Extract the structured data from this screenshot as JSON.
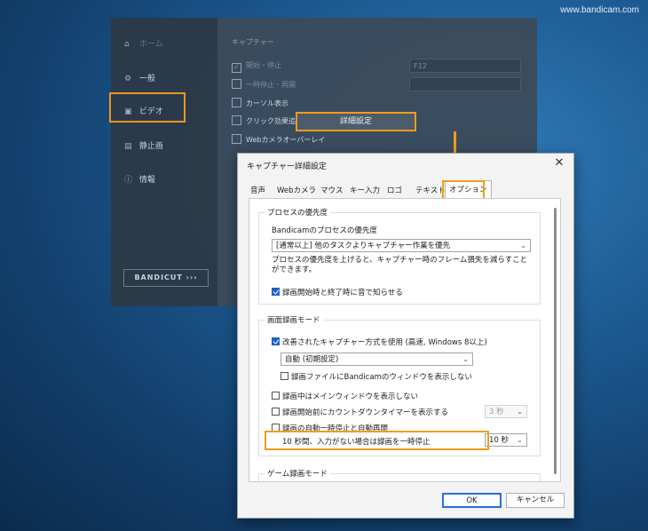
{
  "watermark": "www.bandicam.com",
  "bg_app": {
    "sidebar": {
      "items": [
        {
          "label": "ホーム",
          "icon": "home-icon"
        },
        {
          "label": "一般",
          "icon": "gear-icon"
        },
        {
          "label": "ビデオ",
          "icon": "video-icon"
        },
        {
          "label": "静止画",
          "icon": "image-icon"
        },
        {
          "label": "情報",
          "icon": "info-icon"
        }
      ],
      "bandicut_label": "BANDICUT ›››"
    },
    "section_label": "キャプチャー",
    "options": [
      {
        "label": "開始・停止",
        "checked": true
      },
      {
        "label": "一時停止・再開",
        "checked": false
      },
      {
        "label": "カーソル表示",
        "checked": false
      },
      {
        "label": "クリック効果追加",
        "checked": false
      },
      {
        "label": "Webカメラオーバーレイ",
        "checked": false
      }
    ],
    "hotkey_value": "F12",
    "hotkey2_value": "",
    "advanced_button": "詳細設定",
    "fragments": [
      "フ",
      "ピ",
      "オ"
    ]
  },
  "accent_color": "#f29b1b",
  "dialog": {
    "title": "キャプチャー詳細設定",
    "close_glyph": "✕",
    "tabs": [
      "音声",
      "Webカメラ",
      "マウス",
      "キー入力",
      "ロゴ",
      "テキスト",
      "オプション"
    ],
    "active_tab": "オプション",
    "priority_group": {
      "label": "プロセスの優先度",
      "sub_label": "Bandicamのプロセスの優先度",
      "select_value": "[通常以上] 他のタスクよりキャプチャー作業を優先",
      "description": "プロセスの優先度を上げると、キャプチャー時のフレーム損失を減らすことができます。",
      "sound_checkbox": {
        "label": "録画開始時と終了時に音で知らせる",
        "checked": true
      }
    },
    "screen_mode_group": {
      "label": "画面録画モード",
      "improved_checkbox": {
        "label": "改善されたキャプチャー方式を使用 (高速, Windows 8以上)",
        "checked": true
      },
      "mode_select": "自動 (初期設定)",
      "hide_window_checkbox": {
        "label": "録画ファイルにBandicamのウィンドウを表示しない",
        "checked": false
      },
      "hide_main_checkbox": {
        "label": "録画中はメインウィンドウを表示しない",
        "checked": false
      },
      "countdown_checkbox": {
        "label": "録画開始前にカウントダウンタイマーを表示する",
        "checked": false
      },
      "countdown_select": "3 秒",
      "auto_pause_checkbox": {
        "label": "録画の自動一時停止と自動再開",
        "checked": false
      },
      "auto_pause_desc": "10 秒間、入力がない場合は録画を一時停止",
      "auto_pause_select": "10 秒"
    },
    "game_mode_group": {
      "label": "ゲーム録画モード"
    },
    "ok_button": "OK",
    "cancel_button": "キャンセル"
  }
}
